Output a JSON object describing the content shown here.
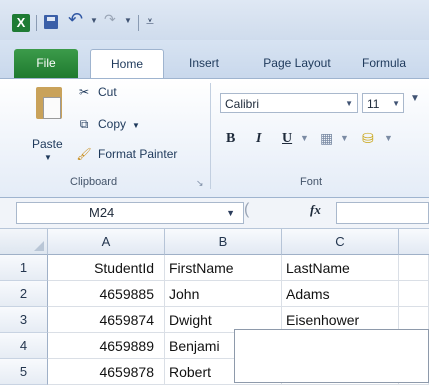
{
  "qat": {
    "app_icon": "X"
  },
  "tabs": [
    {
      "key": "file",
      "label": "File"
    },
    {
      "key": "home",
      "label": "Home"
    },
    {
      "key": "insert",
      "label": "Insert"
    },
    {
      "key": "page_layout",
      "label": "Page Layout"
    },
    {
      "key": "formulas",
      "label": "Formula"
    }
  ],
  "clipboard": {
    "paste_label": "Paste",
    "cut_label": "Cut",
    "copy_label": "Copy",
    "format_painter_label": "Format Painter",
    "group_label": "Clipboard"
  },
  "font": {
    "name": "Calibri",
    "size": "11",
    "group_label": "Font"
  },
  "formula_bar": {
    "name_box": "M24",
    "fx_label": "fx"
  },
  "grid": {
    "columns": [
      "A",
      "B",
      "C"
    ],
    "rows": [
      {
        "n": "1",
        "a": "StudentId",
        "b": "FirstName",
        "c": "LastName"
      },
      {
        "n": "2",
        "a": "4659885",
        "b": "John",
        "c": "Adams"
      },
      {
        "n": "3",
        "a": "4659874",
        "b": "Dwight",
        "c": "Eisenhower"
      },
      {
        "n": "4",
        "a": "4659889",
        "b": "Benjami",
        "c": ""
      },
      {
        "n": "5",
        "a": "4659878",
        "b": "Robert",
        "c": ""
      }
    ]
  },
  "colors": {
    "file_tab": "#1f7a2f",
    "ribbon_bg": "#e4ecf7",
    "header_bg": "#e2e9f3"
  }
}
